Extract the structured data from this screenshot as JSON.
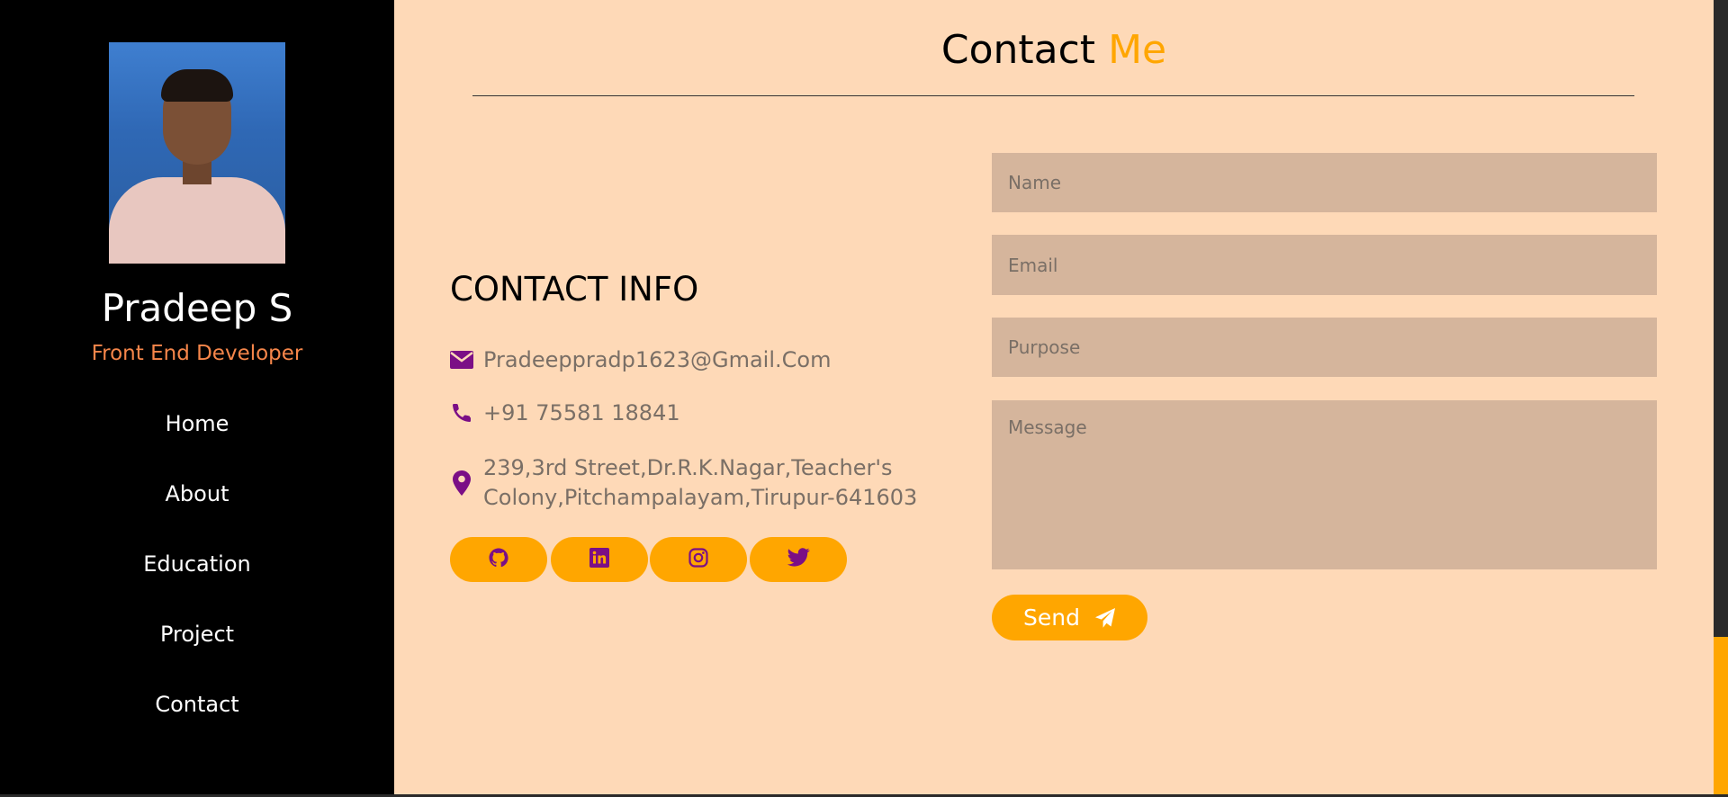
{
  "sidebar": {
    "name": "Pradeep S",
    "role": "Front End Developer",
    "nav": [
      "Home",
      "About",
      "Education",
      "Project",
      "Contact"
    ]
  },
  "header": {
    "title_main": "Contact",
    "title_accent": "Me"
  },
  "contact_info": {
    "heading": "CONTACT INFO",
    "email": "Pradeeppradp1623@Gmail.Com",
    "phone": "+91 75581 18841",
    "address_line1": "239,3rd Street,Dr.R.K.Nagar,Teacher's",
    "address_line2": "Colony,Pitchampalayam,Tirupur-641603",
    "icons": [
      "envelope-icon",
      "phone-icon",
      "map-marker-icon"
    ]
  },
  "social": [
    "github-icon",
    "linkedin-icon",
    "instagram-icon",
    "twitter-icon"
  ],
  "form": {
    "name_placeholder": "Name",
    "email_placeholder": "Email",
    "purpose_placeholder": "Purpose",
    "message_placeholder": "Message",
    "send_label": "Send"
  },
  "colors": {
    "accent": "#ffa600",
    "role": "#f6864a",
    "icon": "#7b0f86",
    "background": "#fed9b7",
    "field": "#d5b59c",
    "sidebar": "#000000"
  }
}
